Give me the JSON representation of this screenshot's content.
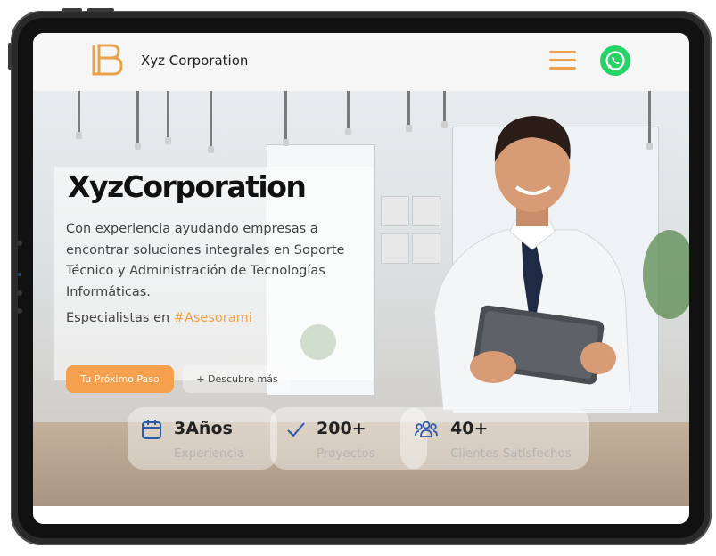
{
  "header": {
    "brand_name": "Xyz Corporation",
    "logo_letter": "LB",
    "menu_icon": "hamburger-icon",
    "whatsapp_icon": "whatsapp-icon"
  },
  "hero": {
    "title": "XyzCorporation",
    "description": "Con experiencia ayudando empresas a encontrar soluciones integrales en Soporte Técnico y Administración de Tecnologías Informáticas.",
    "specialists_prefix": "Especialistas en ",
    "specialists_highlight": "#Asesorami",
    "primary_button": "Tu Próximo Paso",
    "secondary_button": "+ Descubre más"
  },
  "stats": [
    {
      "value": "3Años",
      "label": "Experiencia",
      "icon": "calendar-icon"
    },
    {
      "value": "200+",
      "label": "Proyectos",
      "icon": "check-icon"
    },
    {
      "value": "40+",
      "label": "Clientes Satisfechos",
      "icon": "users-icon"
    }
  ],
  "colors": {
    "accent": "#f4a04d",
    "whatsapp": "#25D366",
    "stat_icon": "#2d5aa8"
  }
}
